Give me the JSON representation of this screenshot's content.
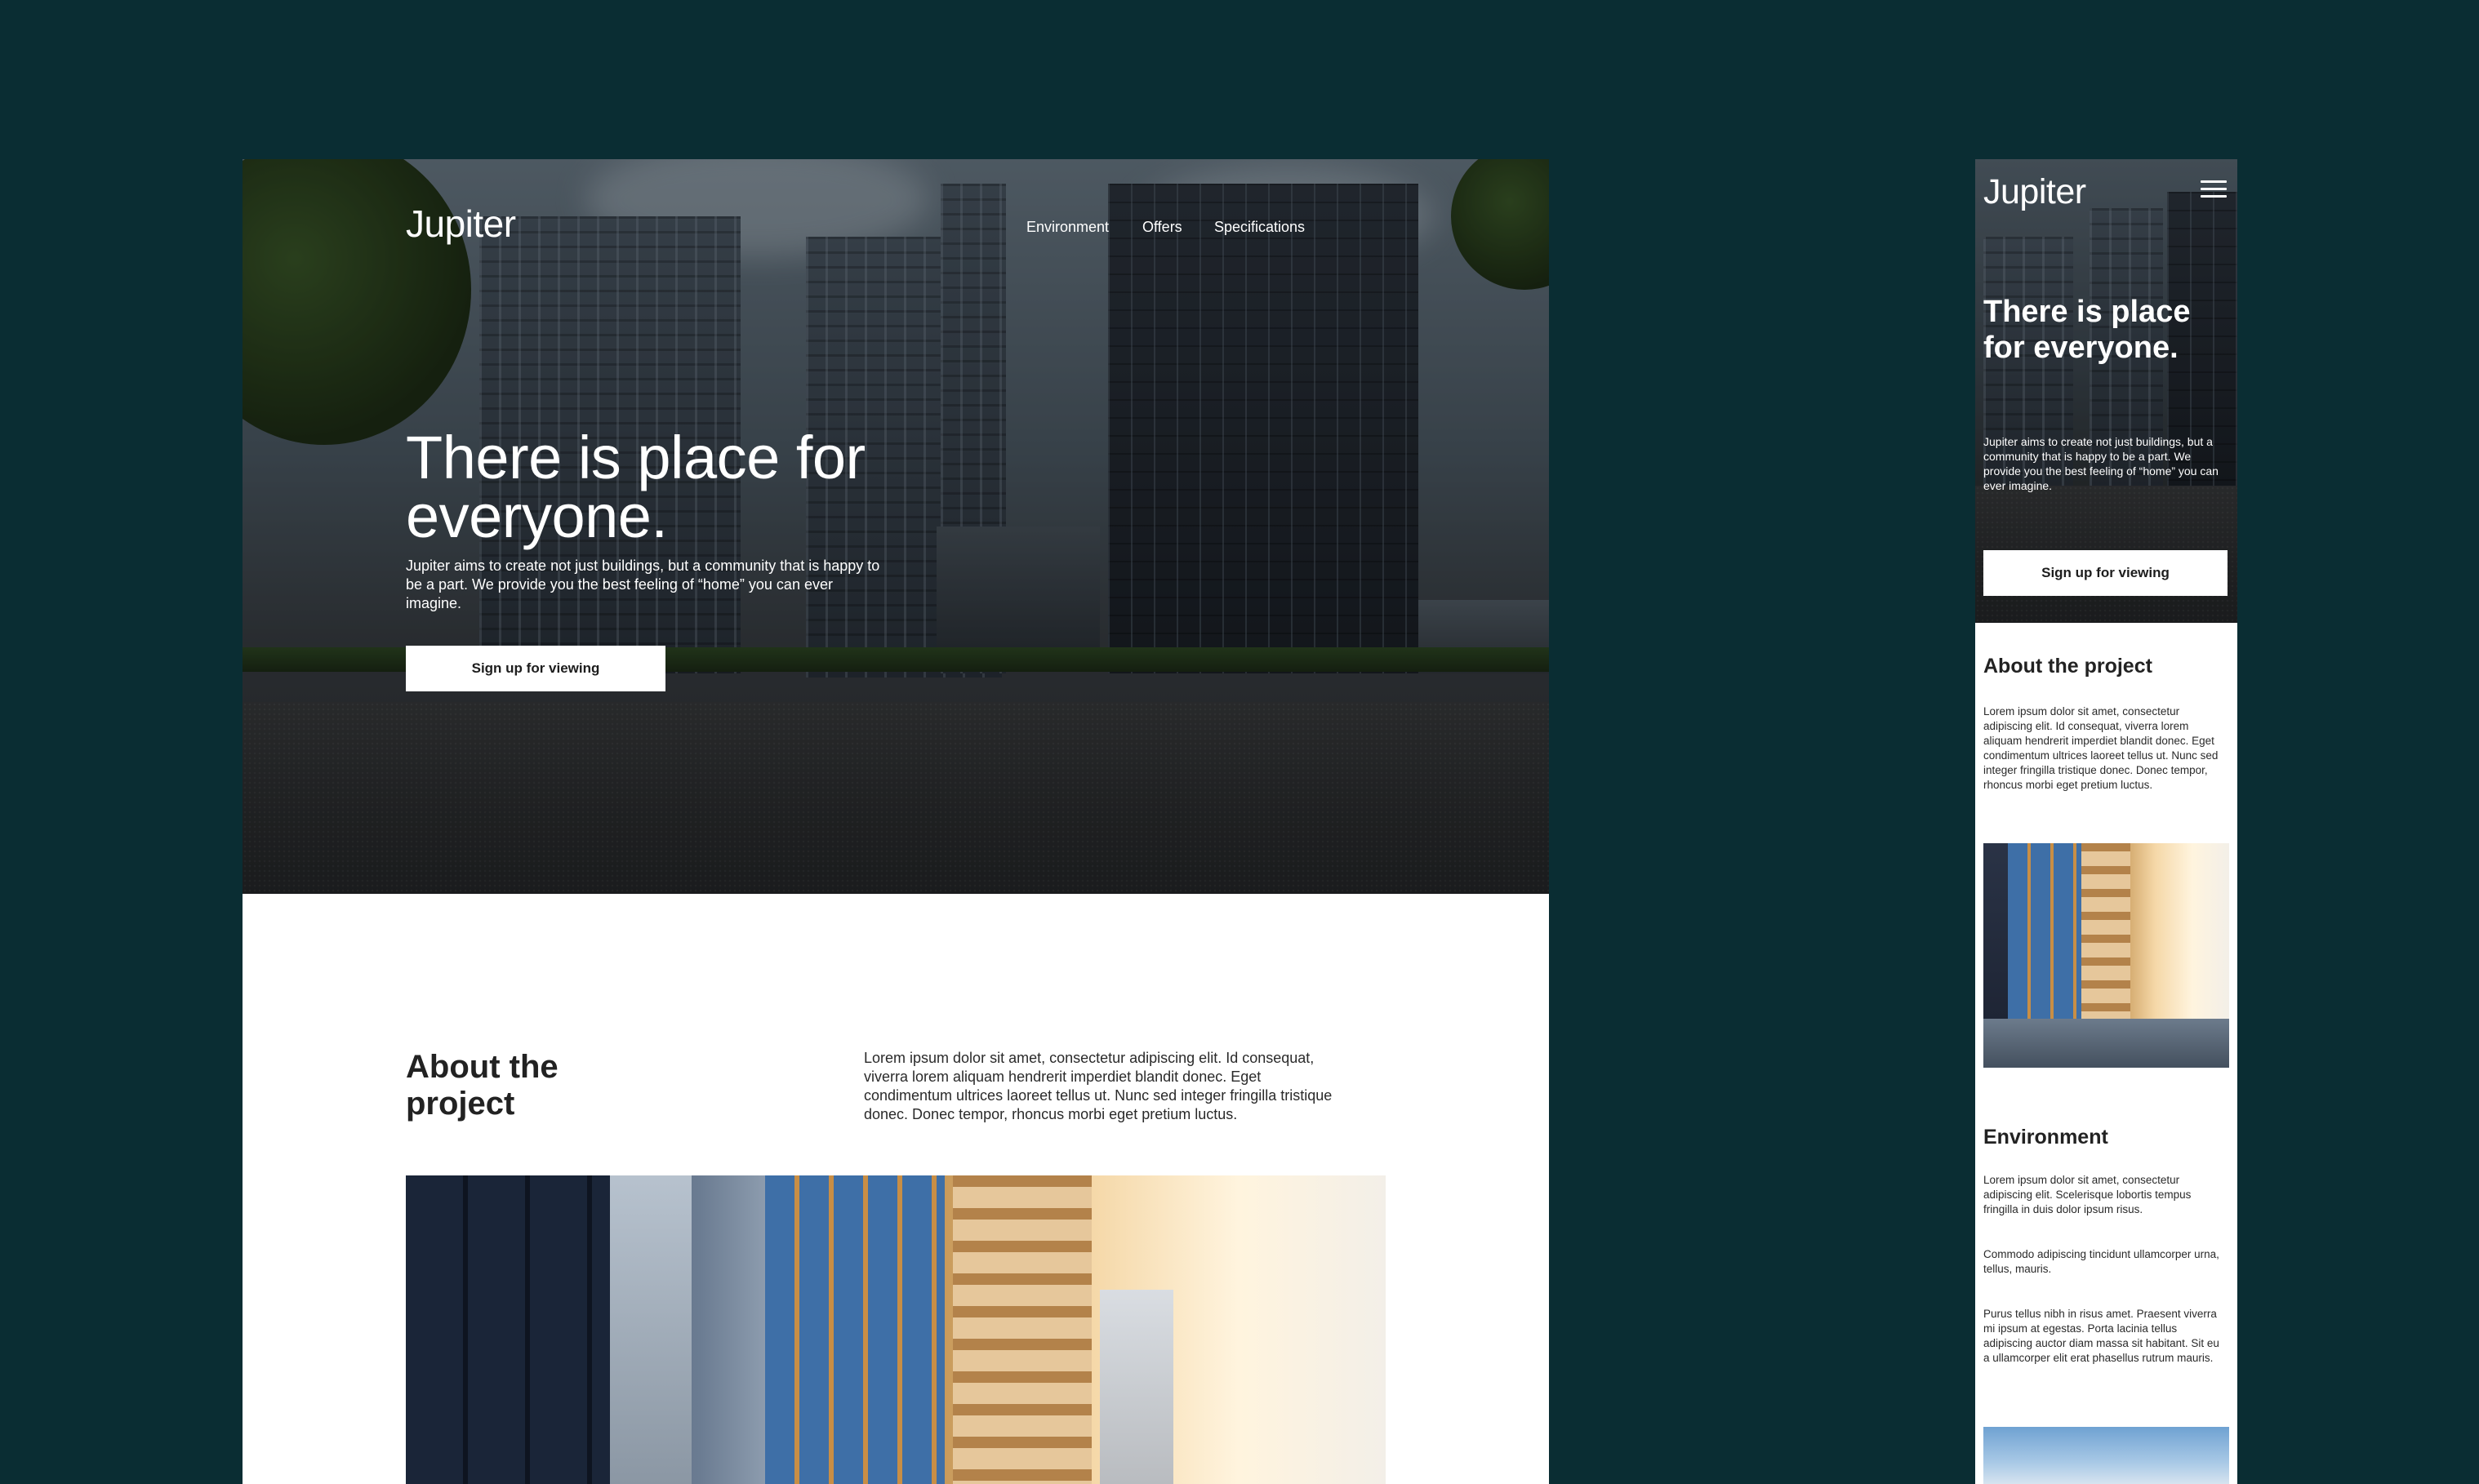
{
  "desktop": {
    "logo": "Jupiter",
    "nav": [
      "Environment",
      "Offers",
      "Specifications"
    ],
    "hero": {
      "title": "There is place for everyone.",
      "text": "Jupiter aims to create not just buildings, but a community that is happy to be a part. We provide you the best feeling of “home” you can ever imagine.",
      "cta": "Sign up for viewing"
    },
    "about": {
      "title": "About the project",
      "text": "Lorem ipsum dolor sit amet, consectetur adipiscing elit. Id consequat, viverra lorem aliquam hendrerit imperdiet blandit donec. Eget condimentum ultrices laoreet tellus ut. Nunc sed integer fringilla tristique donec. Donec tempor, rhoncus morbi eget pretium luctus."
    }
  },
  "mobile": {
    "logo": "Jupiter",
    "hero": {
      "title": "There is place for everyone.",
      "text": "Jupiter aims to create not just buildings, but a community that is happy to be a part. We provide you the best feeling of “home” you can ever imagine.",
      "cta": "Sign up for viewing"
    },
    "about": {
      "title": "About the project",
      "text": "Lorem ipsum dolor sit amet, consectetur adipiscing elit. Id consequat, viverra lorem aliquam hendrerit imperdiet blandit donec. Eget condimentum ultrices laoreet tellus ut. Nunc sed integer fringilla tristique donec. Donec tempor, rhoncus morbi eget pretium luctus."
    },
    "environment": {
      "title": "Environment",
      "p1": "Lorem ipsum dolor sit amet, consectetur adipiscing elit. Scelerisque lobortis tempus fringilla in duis dolor ipsum risus.",
      "p2": "Commodo adipiscing tincidunt ullamcorper urna, tellus, mauris.",
      "p3": "Purus tellus nibh in risus amet. Praesent viverra mi ipsum at egestas. Porta lacinia tellus adipiscing auctor diam massa sit habitant. Sit eu a ullamcorper elit erat phasellus rutrum mauris."
    }
  },
  "colors": {
    "background": "#0a2d33",
    "white": "#ffffff",
    "text": "#222222"
  },
  "icons": {
    "menu": "hamburger-menu-icon"
  }
}
